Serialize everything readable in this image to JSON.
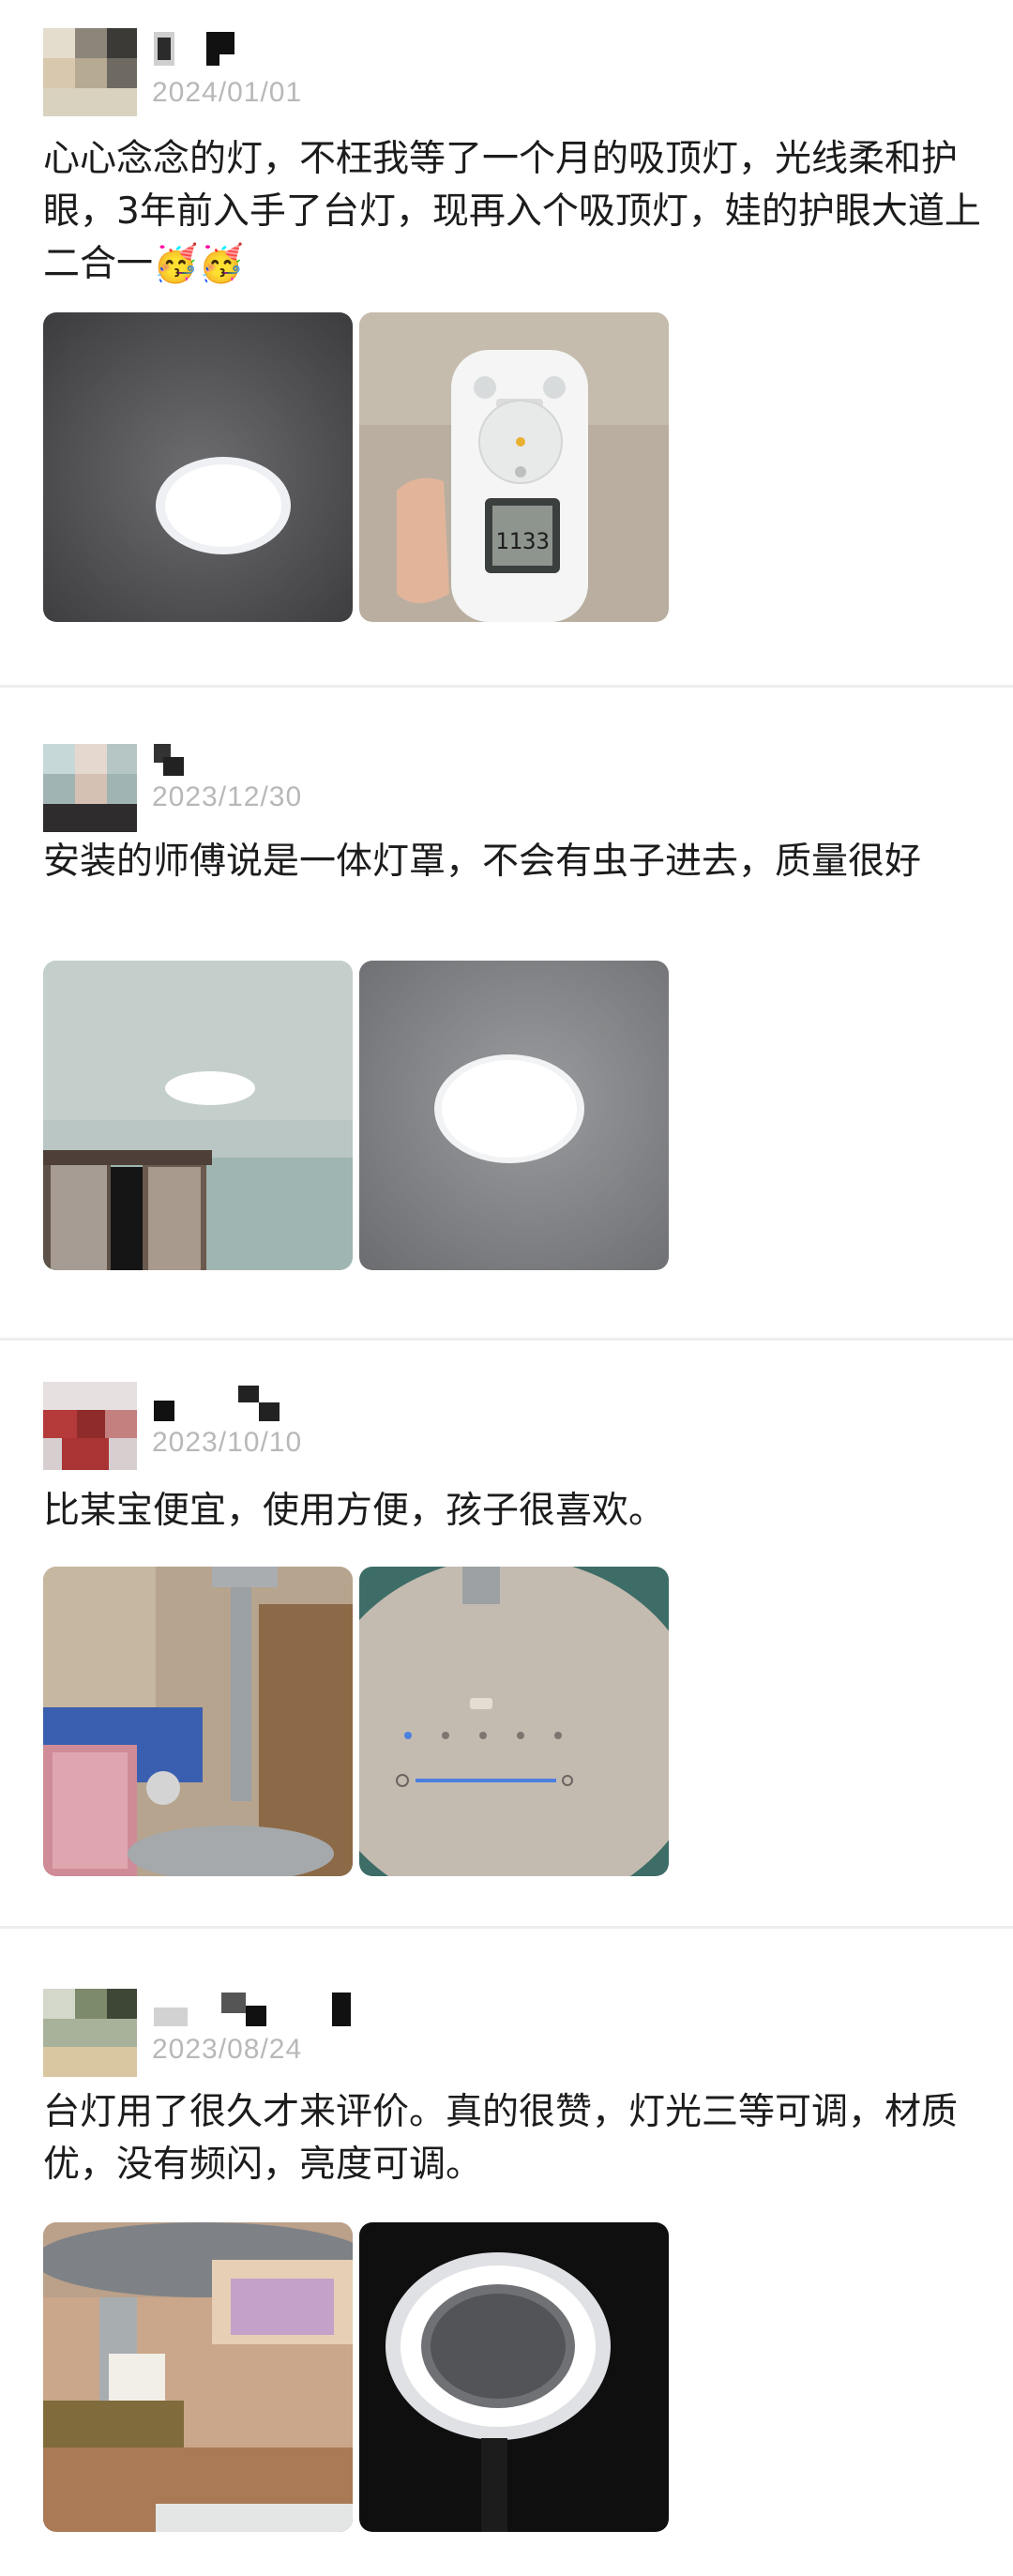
{
  "reviews": [
    {
      "date": "2024/01/01",
      "text": "心心念念的灯，不枉我等了一个月的吸顶灯，光线柔和护眼，3年前入手了台灯，现再入个吸顶灯，娃的护眼大道上二合一🥳🥳",
      "remote_display": "1133"
    },
    {
      "date": "2023/12/30",
      "text": "安装的师傅说是一体灯罩，不会有虫子进去，质量很好"
    },
    {
      "date": "2023/10/10",
      "text": "比某宝便宜，使用方便，孩子很喜欢。"
    },
    {
      "date": "2023/08/24",
      "text": "台灯用了很久才来评价。真的很赞，灯光三等可调，材质优，没有频闪，亮度可调。"
    }
  ]
}
